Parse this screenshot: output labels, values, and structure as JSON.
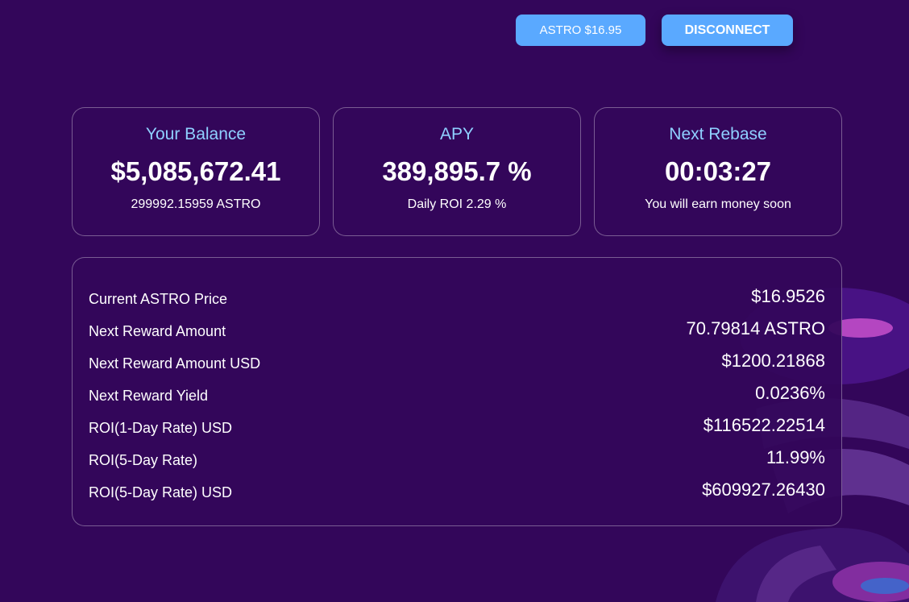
{
  "header": {
    "price_button_label": "ASTRO $16.95",
    "disconnect_label": "DISCONNECT"
  },
  "cards": [
    {
      "title": "Your Balance",
      "value": "$5,085,672.41",
      "sub": "299992.15959 ASTRO"
    },
    {
      "title": "APY",
      "value": "389,895.7 %",
      "sub": "Daily ROI 2.29 %"
    },
    {
      "title": "Next Rebase",
      "value": "00:03:27",
      "sub": "You will earn money soon"
    }
  ],
  "details": {
    "rows": [
      {
        "label": "Current ASTRO Price",
        "value": "$16.9526"
      },
      {
        "label": "Next Reward Amount",
        "value": "70.79814 ASTRO"
      },
      {
        "label": "Next Reward Amount USD",
        "value": "$1200.21868"
      },
      {
        "label": "Next Reward Yield",
        "value": "0.0236%"
      },
      {
        "label": "ROI(1-Day Rate) USD",
        "value": "$116522.22514"
      },
      {
        "label": "ROI(5-Day Rate)",
        "value": "11.99%"
      },
      {
        "label": "ROI(5-Day Rate) USD",
        "value": "$609927.26430"
      }
    ]
  },
  "colors": {
    "background": "#33065a",
    "accent_button": "#5aa9ff",
    "card_title": "#8fd0ff"
  }
}
